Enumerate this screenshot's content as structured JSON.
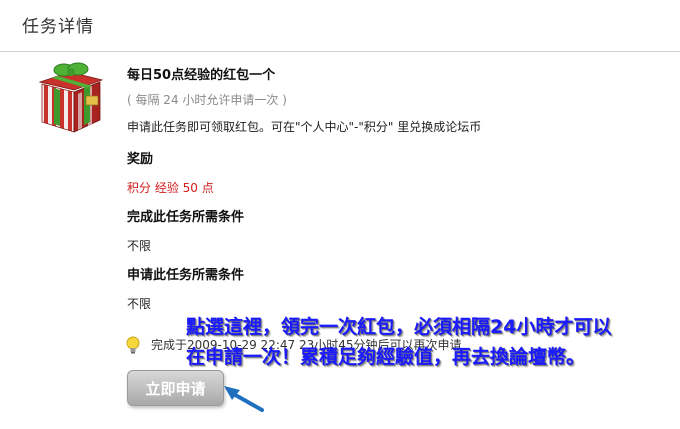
{
  "header": {
    "title": "任务详情"
  },
  "task": {
    "name": "每日50点经验的红包一个",
    "interval": "( 每隔 24 小时允许申请一次 )",
    "description": "申请此任务即可领取红包。可在\"个人中心\"-\"积分\" 里兑换成论坛币"
  },
  "sections": [
    {
      "title": "奖励",
      "value": "积分 经验 50 点"
    },
    {
      "title": "完成此任务所需条件",
      "value": "不限"
    },
    {
      "title": "申请此任务所需条件",
      "value": "不限"
    }
  ],
  "status": {
    "text": "完成于2009-10-29 22:47   23小时45分钟后可以再次申请"
  },
  "apply_button": {
    "label": "立即申请"
  },
  "annotation": {
    "line1": "點選這裡，領完一次紅包，必須相隔24小時才可以",
    "line2": "在申請一次！累積足夠經驗值，再去換論壇幣。"
  },
  "colors": {
    "reward": "#d21e1e",
    "annotation": "#1a1aff",
    "interval": "#8a8a8a"
  },
  "icons": {
    "gift": "gift-box-icon",
    "bulb": "lightbulb-icon",
    "arrow": "pointer-arrow-icon"
  }
}
